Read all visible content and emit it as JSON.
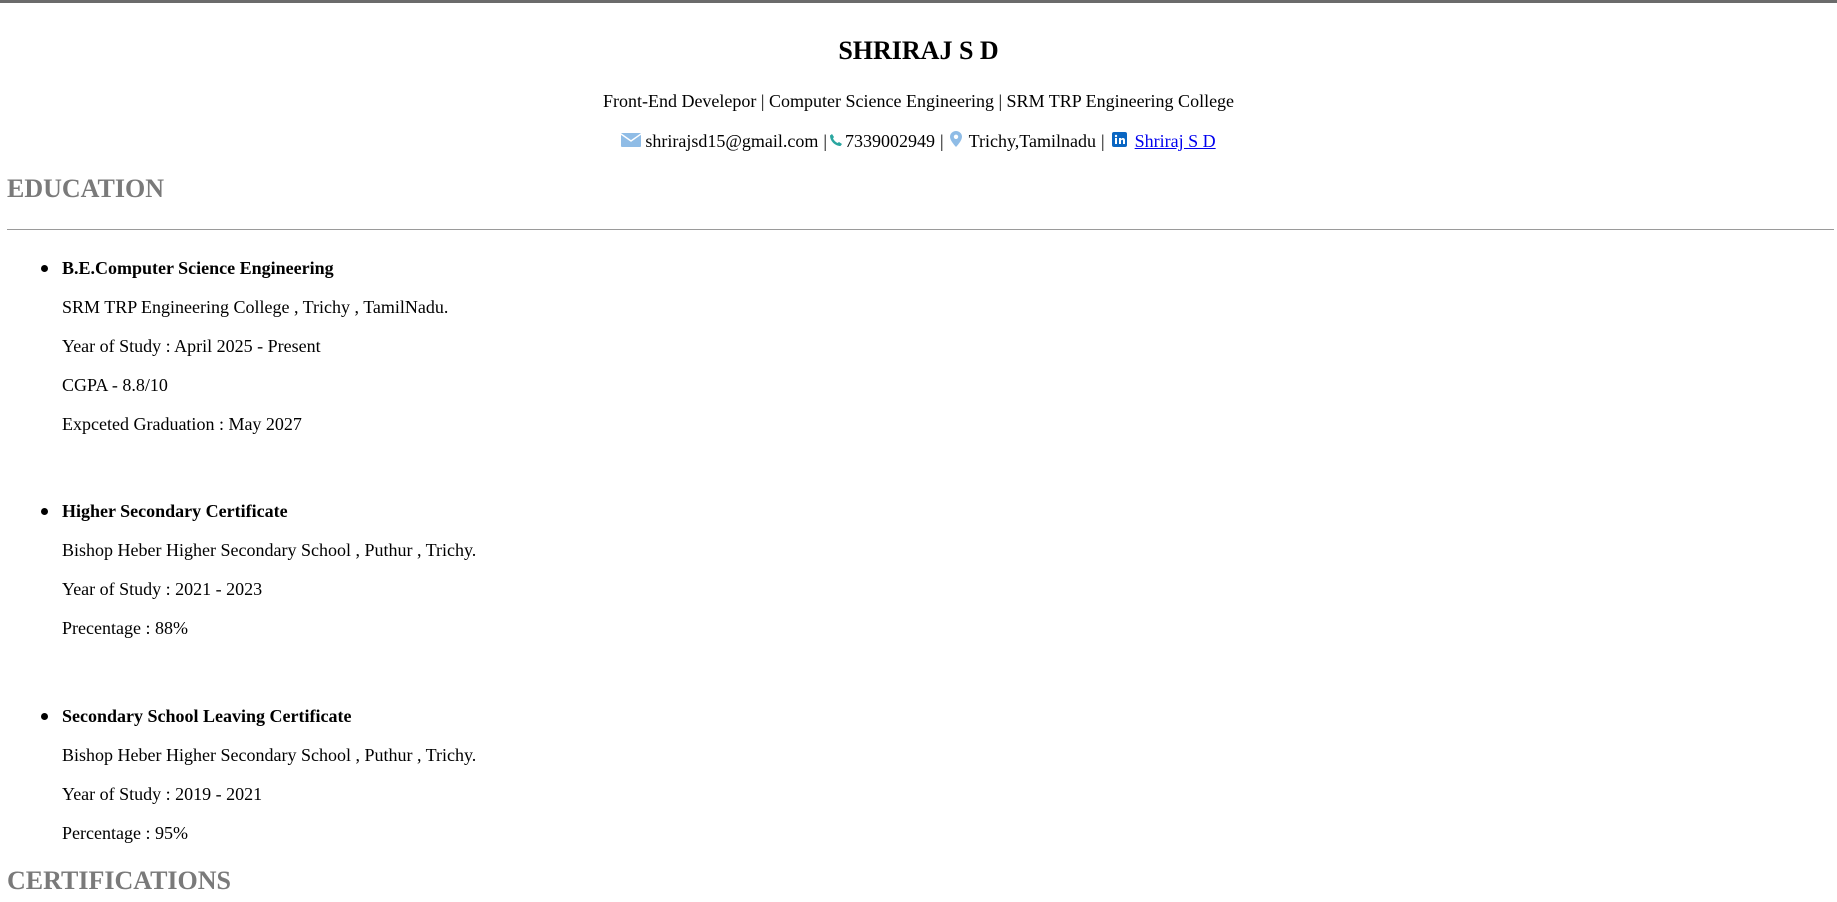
{
  "header": {
    "name": "SHRIRAJ S D",
    "tagline": "Front-End Develepor | Computer Science Engineering | SRM TRP Engineering College",
    "contact": {
      "email": "shrirajsd15@gmail.com",
      "sep1": "|",
      "phone": "7339002949",
      "sep2": "|",
      "location": "Trichy,Tamilnadu",
      "sep3": "|",
      "linkedin": "Shriraj S D"
    },
    "icons": {
      "email": "email-icon",
      "phone": "phone-icon",
      "location": "location-pin-icon",
      "linkedin": "linkedin-icon"
    }
  },
  "sections": {
    "education_title": "EDUCATION",
    "certifications_title": "CERTIFICATIONS"
  },
  "education": [
    {
      "degree": "B.E.Computer Science Engineering",
      "lines": [
        "SRM TRP Engineering College , Trichy , TamilNadu.",
        "Year of Study : April 2025 - Present",
        "CGPA - 8.8/10",
        "Expceted Graduation : May 2027"
      ]
    },
    {
      "degree": "Higher Secondary Certificate",
      "lines": [
        "Bishop Heber Higher Secondary School , Puthur , Trichy.",
        "Year of Study : 2021 - 2023",
        "Precentage : 88%"
      ]
    },
    {
      "degree": "Secondary School Leaving Certificate",
      "lines": [
        "Bishop Heber Higher Secondary School , Puthur , Trichy.",
        "Year of Study : 2019 - 2021",
        "Percentage : 95%"
      ]
    }
  ],
  "colors": {
    "section_title": "#7a7a7a",
    "link": "#0000ee",
    "linkedin": "#0a66c2",
    "email_icon": "#8fbce6",
    "phone_icon": "#2aa6a0",
    "pin_icon": "#8fbce6"
  }
}
